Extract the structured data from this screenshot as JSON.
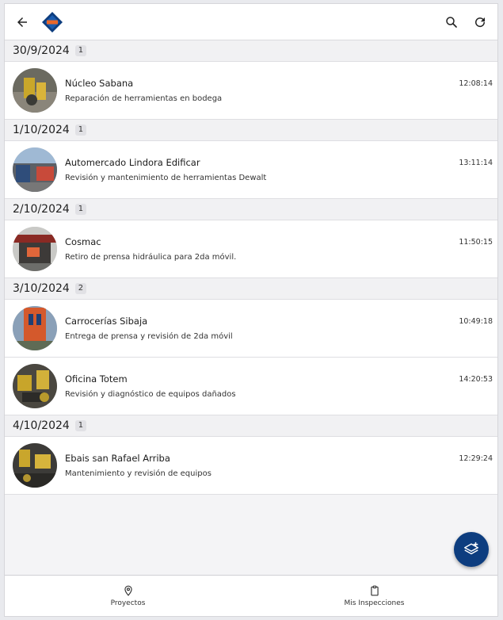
{
  "header": {
    "back_icon": "arrow-left-icon",
    "logo": "brand-diamond-logo",
    "search_icon": "search-icon",
    "refresh_icon": "refresh-icon"
  },
  "groups": [
    {
      "date": "30/9/2024",
      "count": "1",
      "items": [
        {
          "title": "Núcleo Sabana",
          "subtitle": "Reparación de herramientas en bodega",
          "time": "12:08:14"
        }
      ]
    },
    {
      "date": "1/10/2024",
      "count": "1",
      "items": [
        {
          "title": "Automercado Lindora Edificar",
          "subtitle": "Revisión y mantenimiento de herramientas Dewalt",
          "time": "13:11:14"
        }
      ]
    },
    {
      "date": "2/10/2024",
      "count": "1",
      "items": [
        {
          "title": "Cosmac",
          "subtitle": "Retiro de prensa hidráulica para 2da móvil.",
          "time": "11:50:15"
        }
      ]
    },
    {
      "date": "3/10/2024",
      "count": "2",
      "items": [
        {
          "title": "Carrocerías Sibaja",
          "subtitle": "Entrega de prensa y revisión de 2da móvil",
          "time": "10:49:18"
        },
        {
          "title": "Oficina Totem",
          "subtitle": "Revisión y diagnóstico de equipos dañados",
          "time": "14:20:53"
        }
      ]
    },
    {
      "date": "4/10/2024",
      "count": "1",
      "items": [
        {
          "title": "Ebais san Rafael Arriba",
          "subtitle": "Mantenimiento y revisión de equipos",
          "time": "12:29:24"
        }
      ]
    }
  ],
  "fab": {
    "icon": "add-layers-icon"
  },
  "bottom_nav": [
    {
      "label": "Proyectos",
      "icon": "location-pin-icon"
    },
    {
      "label": "Mis Inspecciones",
      "icon": "clipboard-icon"
    }
  ],
  "colors": {
    "brand": "#0d3d7f",
    "accent": "#e8672a"
  }
}
